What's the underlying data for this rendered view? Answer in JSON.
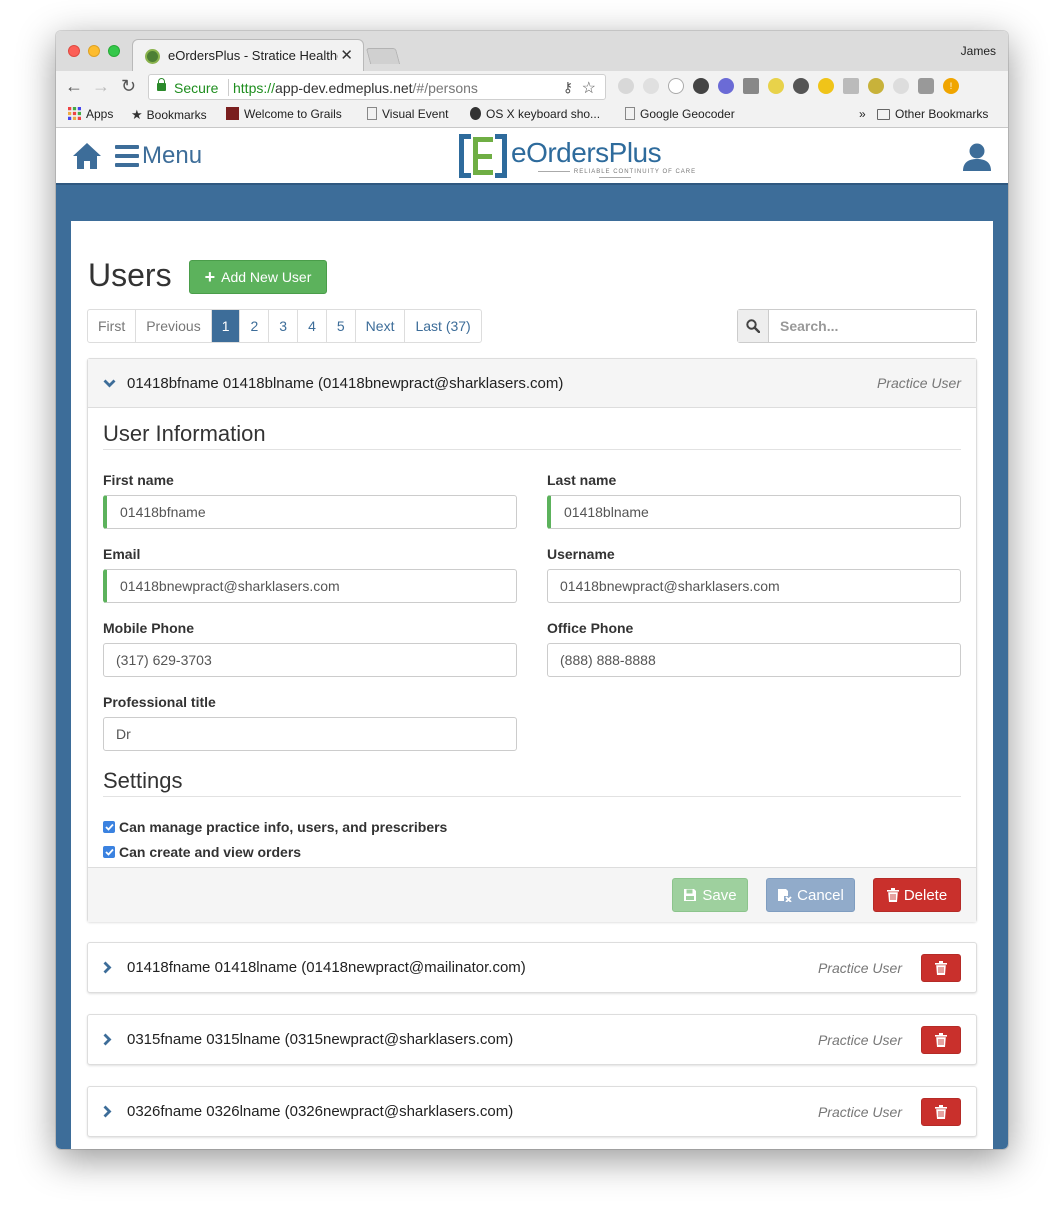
{
  "browser": {
    "tab_title": "eOrdersPlus - Stratice Healthc",
    "profile_name": "James",
    "secure_label": "Secure",
    "url_scheme": "https://",
    "url_host": "app-dev.edmeplus.net",
    "url_path": "/#/persons",
    "bookmarks": {
      "apps": "Apps",
      "bookmarks": "Bookmarks",
      "grails": "Welcome to Grails",
      "visual_event": "Visual Event",
      "osx": "OS X keyboard sho...",
      "geocoder": "Google Geocoder",
      "overflow": "»",
      "other": "Other Bookmarks"
    }
  },
  "header": {
    "menu_label": "Menu",
    "logo_text": "eOrdersPlus",
    "logo_tagline": "RELIABLE CONTINUITY OF CARE"
  },
  "page": {
    "title": "Users",
    "add_button": "Add New User",
    "search_placeholder": "Search..."
  },
  "pagination": {
    "first": "First",
    "previous": "Previous",
    "pages": [
      "1",
      "2",
      "3",
      "4",
      "5"
    ],
    "active_page": "1",
    "next": "Next",
    "last": "Last (37)"
  },
  "expanded_user": {
    "header": "01418bfname 01418blname (01418bnewpract@sharklasers.com)",
    "role": "Practice User",
    "section_info": "User Information",
    "fields": {
      "first_name_label": "First name",
      "first_name": "01418bfname",
      "last_name_label": "Last name",
      "last_name": "01418blname",
      "email_label": "Email",
      "email": "01418bnewpract@sharklasers.com",
      "username_label": "Username",
      "username": "01418bnewpract@sharklasers.com",
      "mobile_label": "Mobile Phone",
      "mobile": "(317) 629-3703",
      "office_label": "Office Phone",
      "office": "(888) 888-8888",
      "title_label": "Professional title",
      "title": "Dr"
    },
    "section_settings": "Settings",
    "settings": [
      "Can manage practice info, users, and prescribers",
      "Can create and view orders"
    ],
    "buttons": {
      "save": "Save",
      "cancel": "Cancel",
      "delete": "Delete"
    }
  },
  "users": [
    {
      "header": "01418fname 01418lname (01418newpract@mailinator.com)",
      "role": "Practice User"
    },
    {
      "header": "0315fname 0315lname (0315newpract@sharklasers.com)",
      "role": "Practice User"
    },
    {
      "header": "0326fname 0326lname (0326newpract@sharklasers.com)",
      "role": "Practice User"
    }
  ],
  "colors": {
    "brand_blue": "#3d6d99",
    "success_green": "#5cb25c",
    "danger_red": "#c9302c"
  }
}
